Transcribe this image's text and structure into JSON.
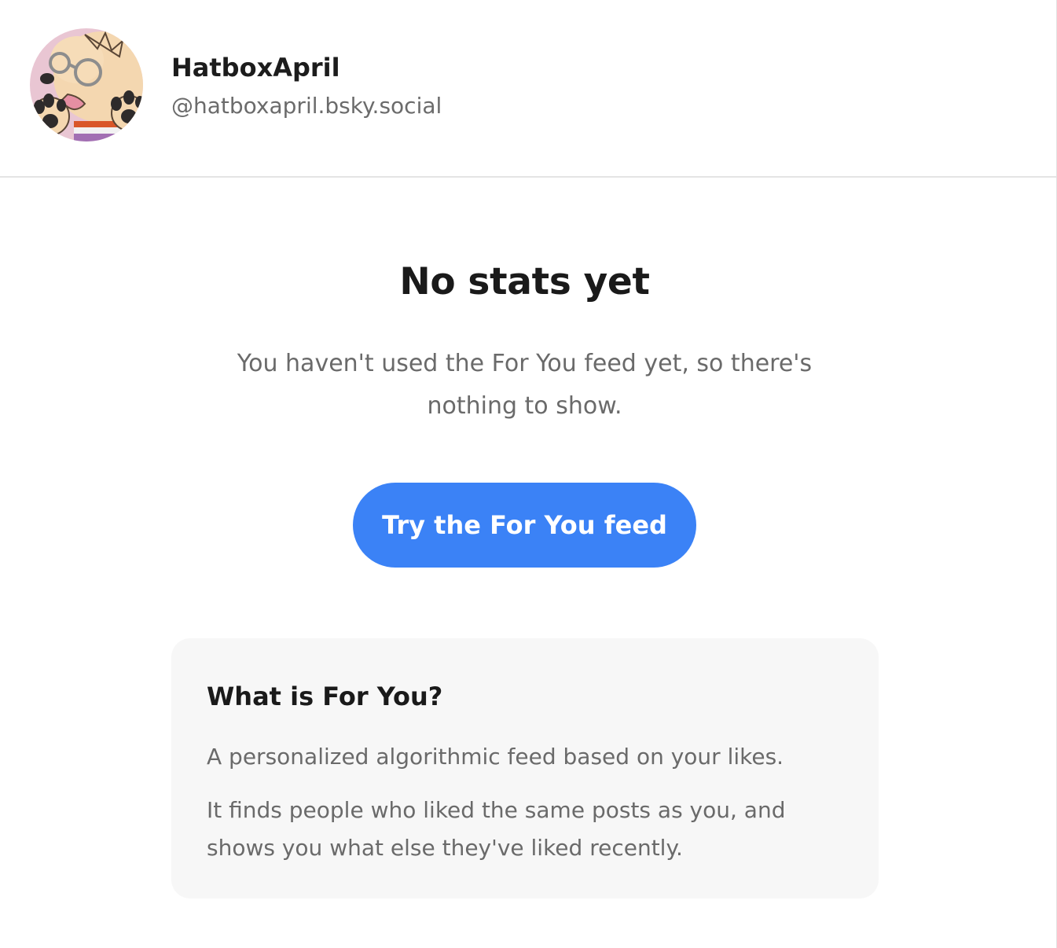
{
  "profile": {
    "display_name": "HatboxApril",
    "handle": "@hatboxapril.bsky.social"
  },
  "empty_state": {
    "title": "No stats yet",
    "description": "You haven't used the For You feed yet, so there's nothing to show.",
    "cta_label": "Try the For You feed"
  },
  "info_card": {
    "title": "What is For You?",
    "paragraph_1": "A personalized algorithmic feed based on your likes.",
    "paragraph_2": "It finds people who liked the same posts as you, and shows you what else they've liked recently."
  },
  "colors": {
    "accent": "#3b82f6",
    "card_background": "#f7f7f7",
    "muted_text": "#6a6a6a"
  }
}
